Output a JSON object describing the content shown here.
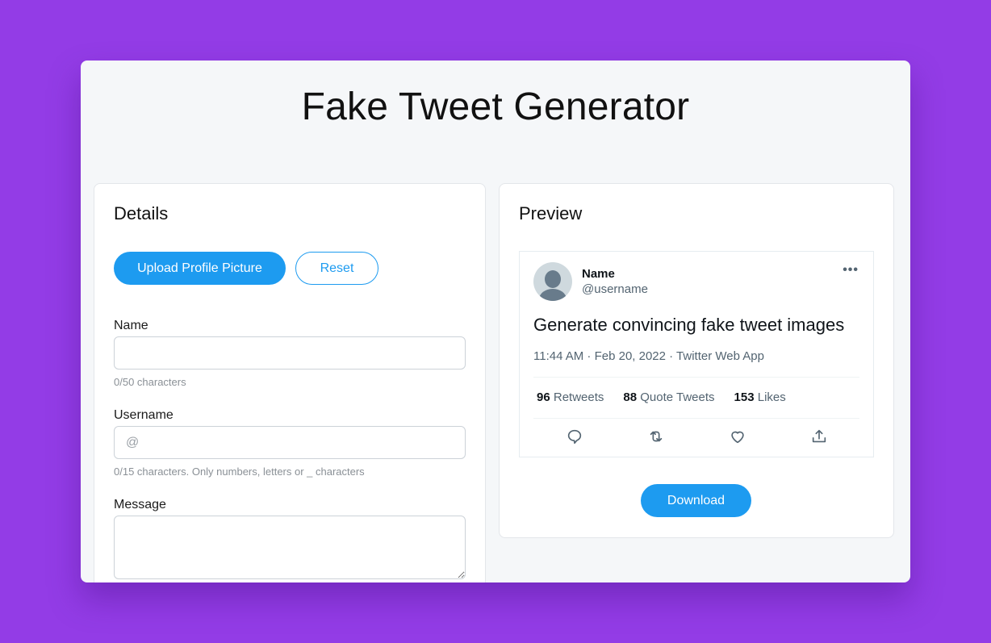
{
  "app": {
    "title": "Fake Tweet Generator"
  },
  "details": {
    "heading": "Details",
    "upload_label": "Upload Profile Picture",
    "reset_label": "Reset",
    "fields": {
      "name": {
        "label": "Name",
        "value": "",
        "placeholder": "",
        "hint": "0/50 characters"
      },
      "username": {
        "label": "Username",
        "value": "",
        "placeholder": "@",
        "hint": "0/15 characters. Only numbers, letters or _ characters"
      },
      "message": {
        "label": "Message",
        "value": "",
        "placeholder": ""
      }
    }
  },
  "preview": {
    "heading": "Preview",
    "tweet": {
      "name": "Name",
      "username": "@username",
      "more_icon": "more-horizontal-icon",
      "text": "Generate convincing fake tweet images",
      "meta": "11:44 AM · Feb 20, 2022 · Twitter Web App",
      "stats": [
        {
          "count": "96",
          "label": "Retweets"
        },
        {
          "count": "88",
          "label": "Quote Tweets"
        },
        {
          "count": "153",
          "label": "Likes"
        }
      ],
      "actions": [
        "reply-icon",
        "retweet-icon",
        "like-icon",
        "share-icon"
      ]
    },
    "download_label": "Download"
  },
  "colors": {
    "background": "#933ce6",
    "accent": "#1d9bf0"
  }
}
